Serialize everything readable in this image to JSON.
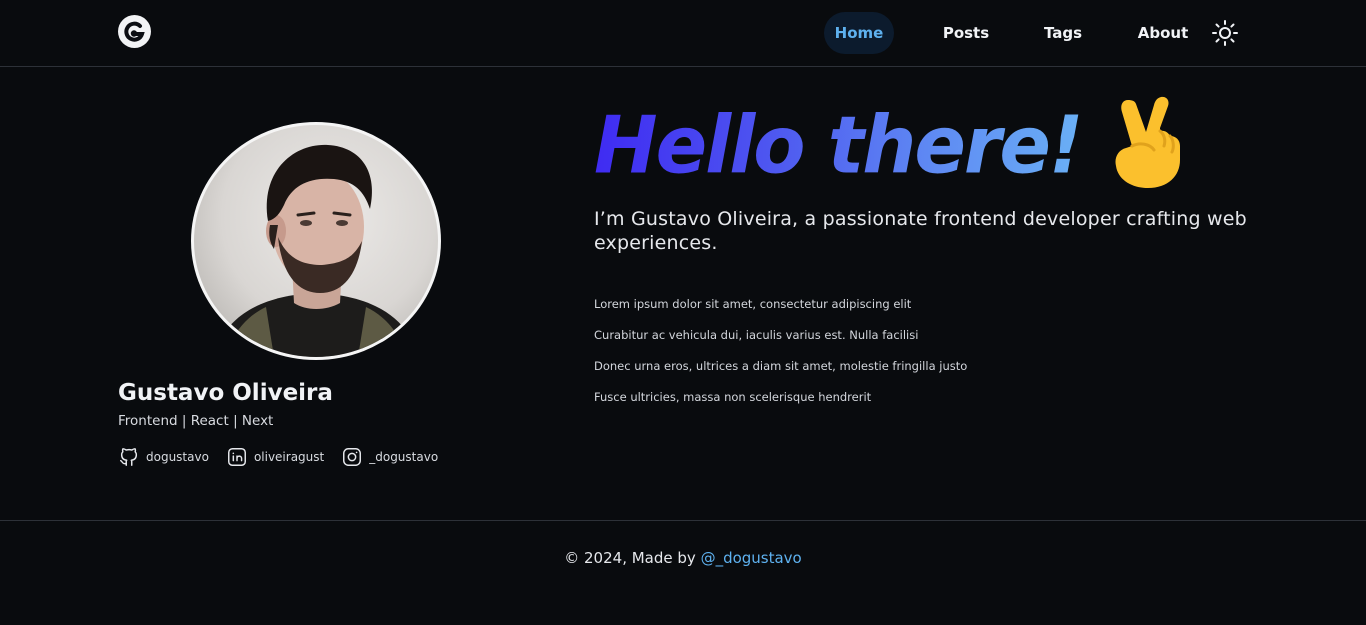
{
  "header": {
    "logo_icon": "logo-g-icon",
    "nav": {
      "home": "Home",
      "posts": "Posts",
      "tags": "Tags",
      "about": "About"
    },
    "theme_icon": "sun-icon",
    "active_color": "#5eb1ef"
  },
  "profile": {
    "name": "Gustavo Oliveira",
    "role": "Frontend | React | Next",
    "socials": [
      {
        "icon": "github-icon",
        "label": "dogustavo"
      },
      {
        "icon": "linkedin-icon",
        "label": "oliveiragust"
      },
      {
        "icon": "instagram-icon",
        "label": "_dogustavo"
      }
    ]
  },
  "hero": {
    "title": "Hello there!",
    "emoji": "victory-hand-emoji",
    "intro": "I’m Gustavo Oliveira, a passionate frontend developer crafting web experiences.",
    "bullets": [
      "Lorem ipsum dolor sit amet, consectetur adipiscing elit",
      "Curabitur ac vehicula dui, iaculis varius est. Nulla facilisi",
      "Donec urna eros, ultrices a diam sit amet, molestie fringilla justo",
      "Fusce ultricies, massa non scelerisque hendrerit"
    ],
    "gradient_start": "#3f2bf2",
    "gradient_end": "#6ab0f5"
  },
  "footer": {
    "text": "© 2024, Made by",
    "link": "@_dogustavo"
  }
}
